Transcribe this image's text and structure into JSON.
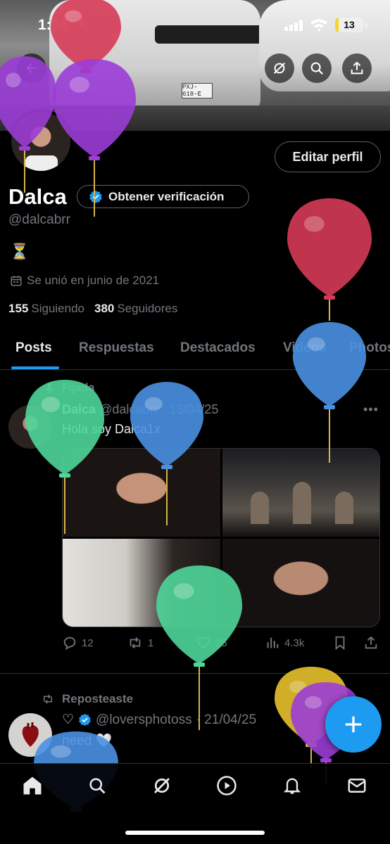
{
  "status_bar": {
    "time": "1:34",
    "battery": "13",
    "battery_level": 0.13
  },
  "banner": {
    "plate": "PXJ-618-E"
  },
  "profile": {
    "display_name": "Dalca",
    "verify_label": "Obtener verificación",
    "edit_label": "Editar perfil",
    "handle": "@dalcabrr",
    "bio_emoji": "⏳",
    "joined": "Se unió en junio de 2021",
    "following_count": "155",
    "following_label": "Siguiendo",
    "followers_count": "380",
    "followers_label": "Seguidores"
  },
  "tabs": [
    {
      "label": "Posts"
    },
    {
      "label": "Respuestas"
    },
    {
      "label": "Destacados"
    },
    {
      "label": "Videos"
    },
    {
      "label": "Photos"
    }
  ],
  "pinned_post": {
    "pinned_label": "Fijada",
    "author": "Dalca",
    "meta": "@dalcabrr · 13/04/25",
    "text": "Hola soy Dalca1x",
    "replies": "12",
    "reposts": "1",
    "likes": "25",
    "views": "4.3k"
  },
  "repost": {
    "label": "Reposteaste",
    "author": "@loversphotoss",
    "date": "· 21/04/25",
    "text": "need 🤍"
  },
  "icons": {
    "back": "arrow-left-icon",
    "grok": "grok-icon",
    "search": "search-icon",
    "share": "share-icon",
    "home": "home-icon",
    "video": "play-icon",
    "notifications": "bell-icon",
    "messages": "mail-icon",
    "compose": "plus-icon"
  },
  "colors": {
    "accent": "#1d9bf0",
    "text": "#e7e9ea",
    "muted": "#71767b",
    "background": "#000000"
  },
  "balloons": [
    "red",
    "purple",
    "purple",
    "red",
    "blue",
    "green",
    "blue",
    "green",
    "yellow",
    "purple",
    "blue"
  ]
}
